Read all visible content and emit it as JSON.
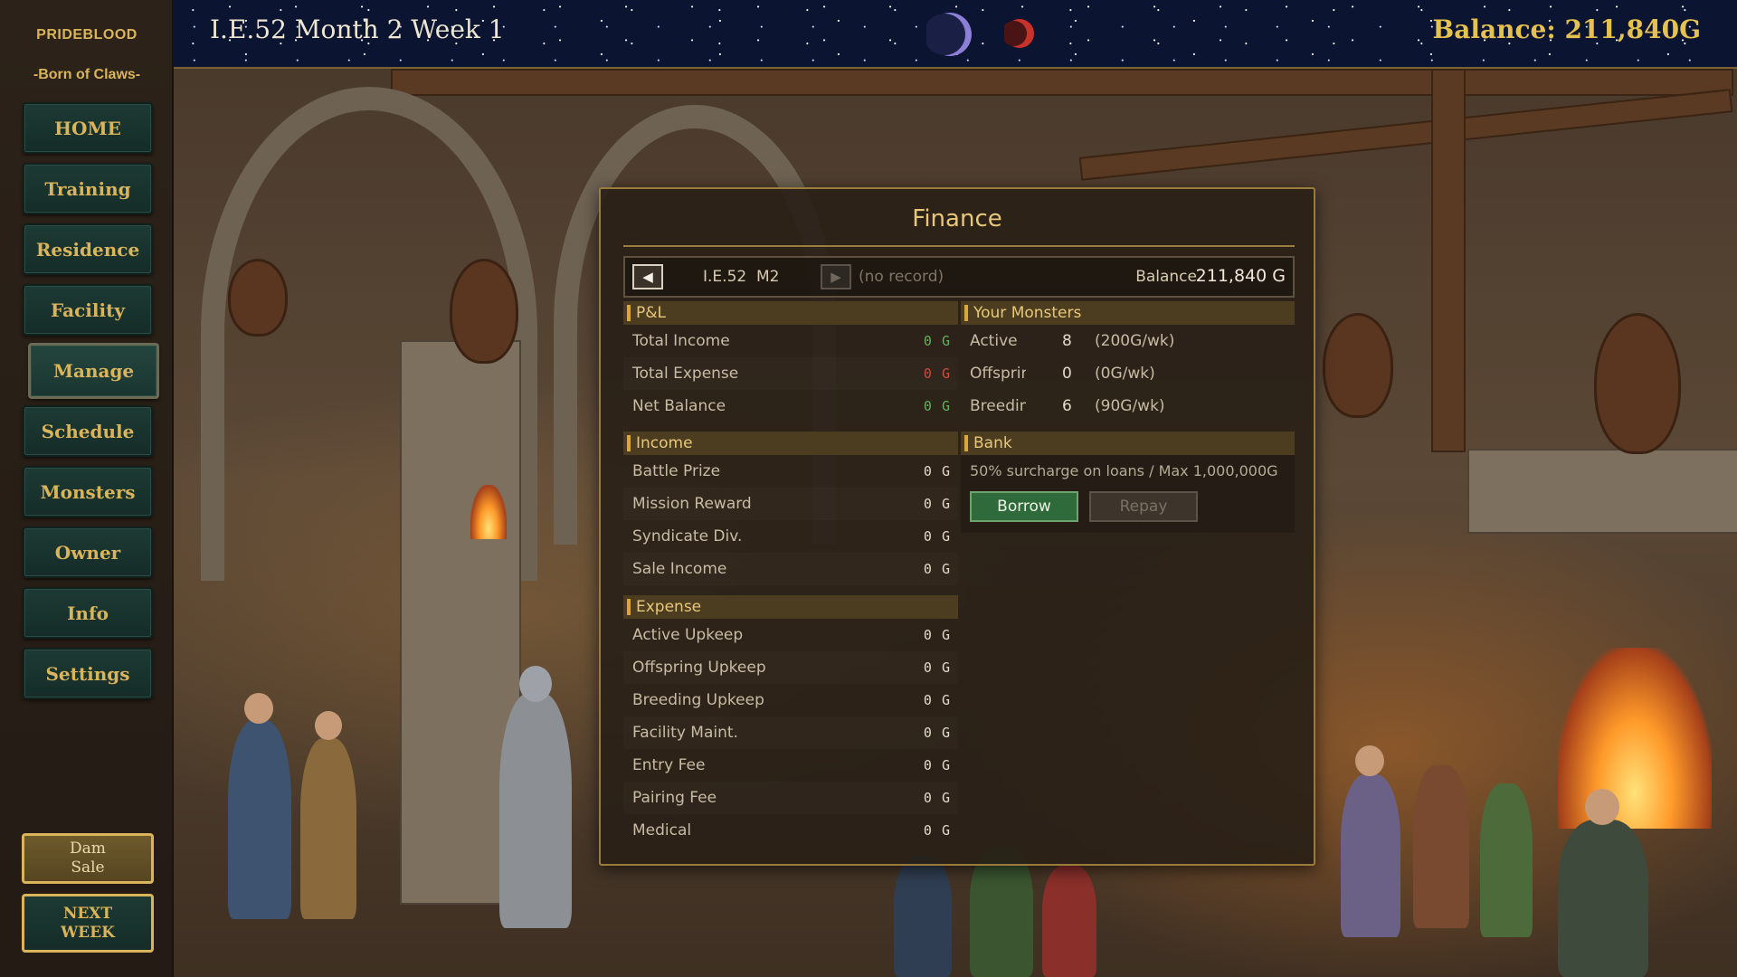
{
  "sidebar": {
    "brand": "PRIDEBLOOD",
    "subtitle": "-Born of Claws-",
    "items": [
      {
        "label": "HOME"
      },
      {
        "label": "Training"
      },
      {
        "label": "Residence"
      },
      {
        "label": "Facility"
      },
      {
        "label": "Manage"
      },
      {
        "label": "Schedule"
      },
      {
        "label": "Monsters"
      },
      {
        "label": "Owner"
      },
      {
        "label": "Info"
      },
      {
        "label": "Settings"
      }
    ],
    "active_item": "Manage",
    "dam_sale": {
      "line1": "Dam",
      "line2": "Sale"
    },
    "next_week": {
      "line1": "NEXT",
      "line2": "WEEK"
    }
  },
  "topbar": {
    "date": "I.E.52 Month 2 Week 1",
    "balance": "Balance: 211,840G",
    "icons": [
      "crescent-moon-icon",
      "red-moon-icon"
    ]
  },
  "finance": {
    "title": "Finance",
    "period": "I.E.52  M2",
    "no_record": "(no record)",
    "balance_label": "Balance",
    "balance_value": "211,840 G",
    "pl": {
      "title": "P&L",
      "rows": [
        {
          "label": "Total Income",
          "value": "0 G",
          "color": "#5fb35a"
        },
        {
          "label": "Total Expense",
          "value": "0 G",
          "color": "#d24b3c"
        },
        {
          "label": "Net Balance",
          "value": "0 G",
          "color": "#5fb35a"
        }
      ]
    },
    "income": {
      "title": "Income",
      "rows": [
        {
          "label": "Battle Prize",
          "value": "0 G"
        },
        {
          "label": "Mission Reward",
          "value": "0 G"
        },
        {
          "label": "Syndicate Div.",
          "value": "0 G"
        },
        {
          "label": "Sale Income",
          "value": "0 G"
        }
      ]
    },
    "expense": {
      "title": "Expense",
      "rows": [
        {
          "label": "Active Upkeep",
          "value": "0 G"
        },
        {
          "label": "Offspring Upkeep",
          "value": "0 G"
        },
        {
          "label": "Breeding Upkeep",
          "value": "0 G"
        },
        {
          "label": "Facility Maint.",
          "value": "0 G"
        },
        {
          "label": "Entry Fee",
          "value": "0 G"
        },
        {
          "label": "Pairing Fee",
          "value": "0 G"
        },
        {
          "label": "Medical",
          "value": "0 G"
        }
      ]
    },
    "monsters": {
      "title": "Your Monsters",
      "rows": [
        {
          "label": "Active",
          "count": "8",
          "rate": "(200G/wk)"
        },
        {
          "label": "Offspring",
          "count": "0",
          "rate": "(0G/wk)"
        },
        {
          "label": "Breeding",
          "count": "6",
          "rate": "(90G/wk)"
        }
      ]
    },
    "bank": {
      "title": "Bank",
      "note": "50% surcharge on loans / Max 1,000,000G",
      "borrow": "Borrow",
      "repay": "Repay"
    }
  }
}
